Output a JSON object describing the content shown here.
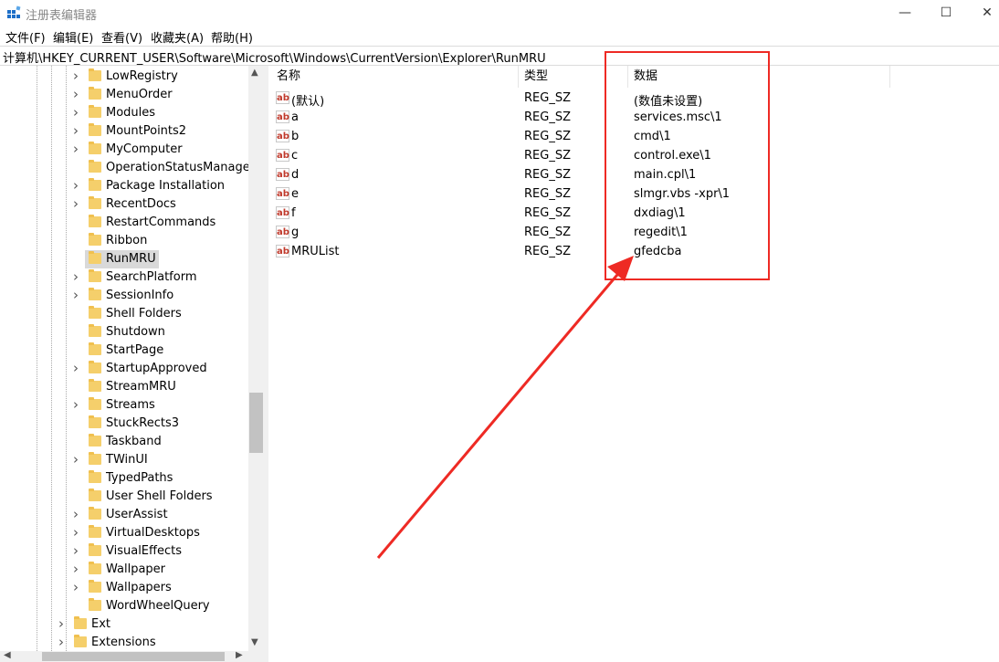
{
  "window": {
    "title": "注册表编辑器",
    "minimize_glyph": "—",
    "maximize_glyph": "☐",
    "close_glyph": "✕"
  },
  "menu": [
    "文件(F)",
    "编辑(E)",
    "查看(V)",
    "收藏夹(A)",
    "帮助(H)"
  ],
  "address": "计算机\\HKEY_CURRENT_USER\\Software\\Microsoft\\Windows\\CurrentVersion\\Explorer\\RunMRU",
  "tree": {
    "items": [
      {
        "label": "LowRegistry",
        "expandable": true
      },
      {
        "label": "MenuOrder",
        "expandable": true
      },
      {
        "label": "Modules",
        "expandable": true
      },
      {
        "label": "MountPoints2",
        "expandable": true
      },
      {
        "label": "MyComputer",
        "expandable": true
      },
      {
        "label": "OperationStatusManager",
        "expandable": false
      },
      {
        "label": "Package Installation",
        "expandable": true
      },
      {
        "label": "RecentDocs",
        "expandable": true
      },
      {
        "label": "RestartCommands",
        "expandable": false
      },
      {
        "label": "Ribbon",
        "expandable": false
      },
      {
        "label": "RunMRU",
        "expandable": false,
        "selected": true
      },
      {
        "label": "SearchPlatform",
        "expandable": true
      },
      {
        "label": "SessionInfo",
        "expandable": true
      },
      {
        "label": "Shell Folders",
        "expandable": false
      },
      {
        "label": "Shutdown",
        "expandable": false
      },
      {
        "label": "StartPage",
        "expandable": false
      },
      {
        "label": "StartupApproved",
        "expandable": true
      },
      {
        "label": "StreamMRU",
        "expandable": false
      },
      {
        "label": "Streams",
        "expandable": true
      },
      {
        "label": "StuckRects3",
        "expandable": false
      },
      {
        "label": "Taskband",
        "expandable": false
      },
      {
        "label": "TWinUI",
        "expandable": true
      },
      {
        "label": "TypedPaths",
        "expandable": false
      },
      {
        "label": "User Shell Folders",
        "expandable": false
      },
      {
        "label": "UserAssist",
        "expandable": true
      },
      {
        "label": "VirtualDesktops",
        "expandable": true
      },
      {
        "label": "VisualEffects",
        "expandable": true
      },
      {
        "label": "Wallpaper",
        "expandable": true
      },
      {
        "label": "Wallpapers",
        "expandable": true
      },
      {
        "label": "WordWheelQuery",
        "expandable": false
      }
    ],
    "parent_items": [
      {
        "label": "Ext",
        "expandable": true
      },
      {
        "label": "Extensions",
        "expandable": true
      }
    ]
  },
  "list": {
    "headers": {
      "name": "名称",
      "type": "类型",
      "data": "数据"
    },
    "rows": [
      {
        "name": "(默认)",
        "type": "REG_SZ",
        "data": "(数值未设置)"
      },
      {
        "name": "a",
        "type": "REG_SZ",
        "data": "services.msc\\1"
      },
      {
        "name": "b",
        "type": "REG_SZ",
        "data": "cmd\\1"
      },
      {
        "name": "c",
        "type": "REG_SZ",
        "data": "control.exe\\1"
      },
      {
        "name": "d",
        "type": "REG_SZ",
        "data": "main.cpl\\1"
      },
      {
        "name": "e",
        "type": "REG_SZ",
        "data": "slmgr.vbs -xpr\\1"
      },
      {
        "name": "f",
        "type": "REG_SZ",
        "data": "dxdiag\\1"
      },
      {
        "name": "g",
        "type": "REG_SZ",
        "data": "regedit\\1"
      },
      {
        "name": "MRUList",
        "type": "REG_SZ",
        "data": "gfedcba"
      }
    ]
  },
  "annotation": {
    "color": "#ee2a24"
  }
}
